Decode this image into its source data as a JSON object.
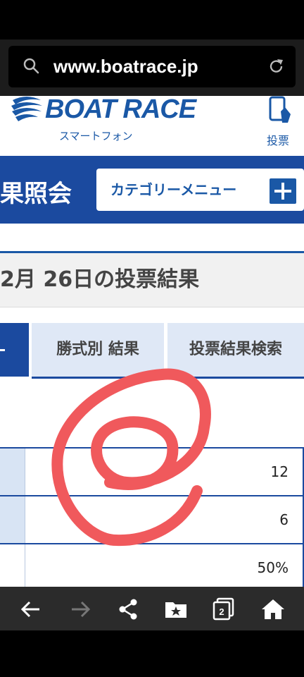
{
  "browser": {
    "url": "www.boatrace.jp",
    "icons": [
      "search-icon",
      "reload-icon"
    ]
  },
  "header": {
    "logo_text": "BOAT RACE",
    "logo_subtitle": "スマートフォン",
    "vote_label": "投票"
  },
  "titlebar": {
    "title": "果照会",
    "category_button": "カテゴリーメニュー"
  },
  "heading": "2月 26日の投票結果",
  "tabs": [
    {
      "label": ""
    },
    {
      "label": "勝式別 結果"
    },
    {
      "label": "投票結果検索"
    }
  ],
  "table": {
    "rows": [
      {
        "value": "12"
      },
      {
        "value": "6"
      },
      {
        "value": "50%"
      }
    ]
  },
  "annotation": {
    "color": "#f0595c"
  },
  "bottom_nav": {
    "icons": [
      "back-icon",
      "forward-icon",
      "share-icon",
      "bookmarks-icon",
      "tabs-icon",
      "home-icon"
    ],
    "tabs_count": "2"
  },
  "colors": {
    "brand": "#1b4a9f",
    "accent_text": "#1a58a6"
  }
}
